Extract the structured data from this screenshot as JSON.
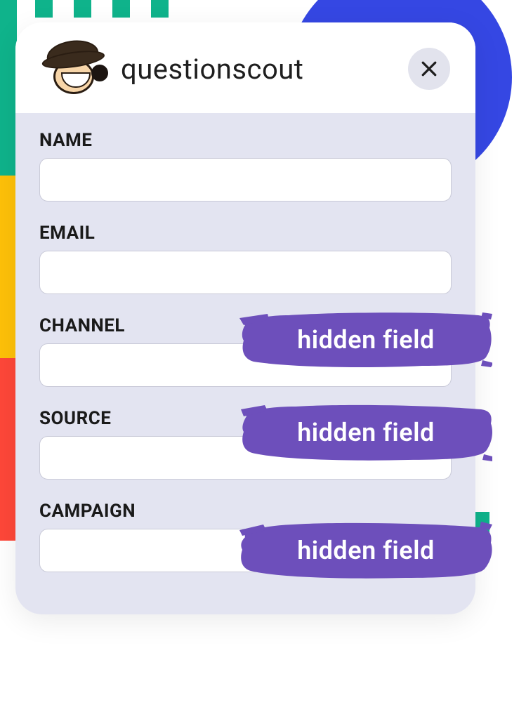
{
  "brand": {
    "name": "questionscout",
    "logo_icon_name": "scout-avatar-icon"
  },
  "header": {
    "close_icon_name": "close-icon"
  },
  "form": {
    "fields": [
      {
        "label": "NAME",
        "value": "",
        "placeholder": "",
        "hidden_badge": false
      },
      {
        "label": "EMAIL",
        "value": "",
        "placeholder": "",
        "hidden_badge": false
      },
      {
        "label": "CHANNEL",
        "value": "",
        "placeholder": "",
        "hidden_badge": true
      },
      {
        "label": "SOURCE",
        "value": "",
        "placeholder": "",
        "hidden_badge": true
      },
      {
        "label": "CAMPAIGN",
        "value": "",
        "placeholder": "",
        "hidden_badge": true
      }
    ]
  },
  "badge": {
    "text": "hidden field",
    "color": "#6d4fbb"
  }
}
